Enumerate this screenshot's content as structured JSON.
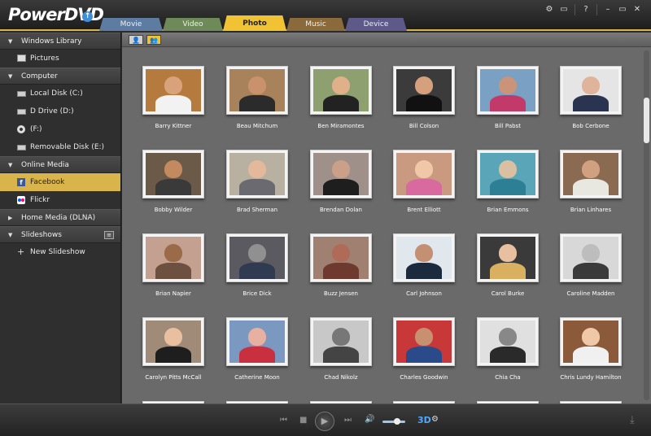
{
  "app": {
    "name": "PowerDVD",
    "update_icon": "up-arrow-icon"
  },
  "tabs": [
    {
      "label": "Movie",
      "color": "#5e7ca2"
    },
    {
      "label": "Video",
      "color": "#6d8a58"
    },
    {
      "label": "Photo",
      "color": "#f1c232"
    },
    {
      "label": "Music",
      "color": "#8a6a3a"
    },
    {
      "label": "Device",
      "color": "#5d5a8a"
    }
  ],
  "active_tab": "Photo",
  "window_controls": [
    "gear-icon",
    "tv-icon",
    "help-icon",
    "minimize-icon",
    "maximize-icon",
    "close-icon"
  ],
  "window_control_glyphs": [
    "⚙",
    "▭",
    "?",
    "–",
    "▭",
    "✕"
  ],
  "sidebar": {
    "sections": [
      {
        "label": "Windows Library",
        "expanded": true,
        "items": [
          {
            "label": "Pictures",
            "icon": "pictures-icon"
          }
        ]
      },
      {
        "label": "Computer",
        "expanded": true,
        "items": [
          {
            "label": "Local Disk (C:)",
            "icon": "drive-icon"
          },
          {
            "label": "D Drive (D:)",
            "icon": "drive-icon"
          },
          {
            "label": "(F:)",
            "icon": "disc-icon"
          },
          {
            "label": "Removable Disk (E:)",
            "icon": "drive-icon"
          }
        ]
      },
      {
        "label": "Online Media",
        "expanded": true,
        "items": [
          {
            "label": "Facebook",
            "icon": "facebook-icon",
            "selected": true
          },
          {
            "label": "Flickr",
            "icon": "flickr-icon"
          }
        ]
      },
      {
        "label": "Home Media (DLNA)",
        "expanded": false,
        "items": []
      },
      {
        "label": "Slideshows",
        "expanded": true,
        "items": [
          {
            "label": "New Slideshow",
            "icon": "plus-icon"
          }
        ]
      }
    ]
  },
  "view_toggle": [
    "single-person-icon",
    "friends-icon"
  ],
  "friends": [
    {
      "name": "Barry Kittner",
      "bg": "#b57a3e",
      "skin": "#d9a27a",
      "shirt": "#f2f2f2"
    },
    {
      "name": "Beau Mitchum",
      "bg": "#a8825a",
      "skin": "#c9926c",
      "shirt": "#2b2b2b"
    },
    {
      "name": "Ben Miramontes",
      "bg": "#8fa070",
      "skin": "#e0b08a",
      "shirt": "#222"
    },
    {
      "name": "Bill Colson",
      "bg": "#3b3b3b",
      "skin": "#d6a07c",
      "shirt": "#111"
    },
    {
      "name": "Bill Pabst",
      "bg": "#7aa0c4",
      "skin": "#c99479",
      "shirt": "#c23a6a"
    },
    {
      "name": "Bob Cerbone",
      "bg": "#e5e5e5",
      "skin": "#e0b49a",
      "shirt": "#2a3350"
    },
    {
      "name": "Bobby Wilder",
      "bg": "#6b5a48",
      "skin": "#c38a60",
      "shirt": "#3a3a3a"
    },
    {
      "name": "Brad Sherman",
      "bg": "#b8b0a0",
      "skin": "#e4b89a",
      "shirt": "#6a6a70"
    },
    {
      "name": "Brendan Dolan",
      "bg": "#a0908a",
      "skin": "#caa088",
      "shirt": "#1e1e1e"
    },
    {
      "name": "Brent Elliott",
      "bg": "#c99a80",
      "skin": "#f0c8a8",
      "shirt": "#d86aa0"
    },
    {
      "name": "Brian Emmons",
      "bg": "#5aa6b8",
      "skin": "#d8c0a0",
      "shirt": "#2d7f95"
    },
    {
      "name": "Brian Linhares",
      "bg": "#8a6a50",
      "skin": "#d0a080",
      "shirt": "#e8e8e0"
    },
    {
      "name": "Brian Napier",
      "bg": "#c4a090",
      "skin": "#9b6a48",
      "shirt": "#6e5040"
    },
    {
      "name": "Brice Dick",
      "bg": "#5a5a60",
      "skin": "#909090",
      "shirt": "#303a50"
    },
    {
      "name": "Buzz Jensen",
      "bg": "#a08070",
      "skin": "#b06a58",
      "shirt": "#6e3a30"
    },
    {
      "name": "Carl Johnson",
      "bg": "#e0e8ee",
      "skin": "#c49074",
      "shirt": "#1c2a3e"
    },
    {
      "name": "Carol Burke",
      "bg": "#3a3a3a",
      "skin": "#e8c0a0",
      "shirt": "#d8b060"
    },
    {
      "name": "Caroline Madden",
      "bg": "#d8d8d8",
      "skin": "#bdbdbd",
      "shirt": "#3a3a3a"
    },
    {
      "name": "Carolyn Pitts McCall",
      "bg": "#a08a78",
      "skin": "#e8c0a0",
      "shirt": "#1e1e1e"
    },
    {
      "name": "Catherine Moon",
      "bg": "#7a98c0",
      "skin": "#e8b0a0",
      "shirt": "#c83040"
    },
    {
      "name": "Chad Nikolz",
      "bg": "#c8c8c8",
      "skin": "#777",
      "shirt": "#444"
    },
    {
      "name": "Charles Goodwin",
      "bg": "#c83838",
      "skin": "#c89070",
      "shirt": "#2a4a8a"
    },
    {
      "name": "Chia Cha",
      "bg": "#e0e0e0",
      "skin": "#888",
      "shirt": "#2a2a2a"
    },
    {
      "name": "Chris Lundy Hamilton",
      "bg": "#8a5a3a",
      "skin": "#f0c8a8",
      "shirt": "#f0f0f0"
    }
  ],
  "player": {
    "glyphs": {
      "prev": "⏮",
      "stop": "■",
      "play": "▶",
      "next": "⏭",
      "volume": "🔊",
      "settings": "⚙",
      "download": "⤓"
    },
    "three_d": "3D",
    "volume_level": 0.65
  }
}
